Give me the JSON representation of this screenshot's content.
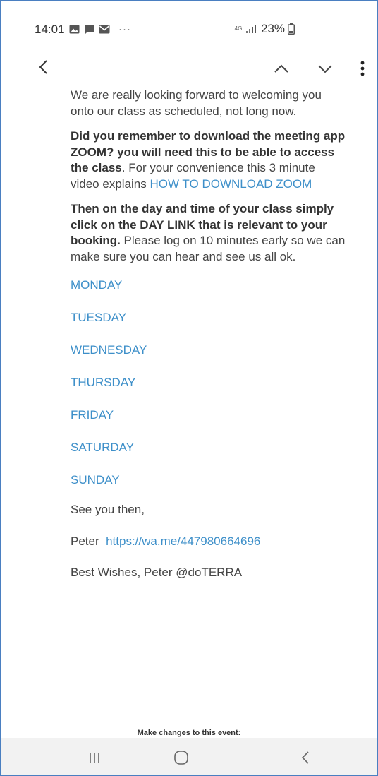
{
  "status_bar": {
    "time": "14:01",
    "ellipsis": "···",
    "network": "4G",
    "battery": "23%",
    "icons": [
      "gallery-icon",
      "chat-icon",
      "mail-icon",
      "signal-icon",
      "battery-icon"
    ]
  },
  "app_bar": {
    "icons": [
      "back-icon",
      "chevron-up-icon",
      "chevron-down-icon",
      "more-vertical-icon"
    ]
  },
  "email": {
    "p1": "We are really looking forward to welcoming you onto our class as scheduled, not long now.",
    "p2_bold": "Did you remember to download the meeting app ZOOM? you will need this to be able to access the class",
    "p2_text": ". For your convenience this 3 minute video explains ",
    "p2_link": "HOW TO DOWNLOAD ZOOM",
    "p3_bold": "Then on the day and time of your class simply click on the DAY LINK that is relevant to your booking.",
    "p3_text": " Please log on 10 minutes early so we can make sure you can hear and see us all ok.",
    "days": [
      "MONDAY",
      "TUESDAY",
      "WEDNESDAY",
      "THURSDAY",
      "FRIDAY",
      "SATURDAY",
      "SUNDAY"
    ],
    "see_you": "See you then,",
    "signoff_name": "Peter",
    "signoff_link": "https://wa.me/447980664696",
    "best_wishes": "Best Wishes, Peter @doTERRA",
    "make_changes": "Make changes to this event:"
  },
  "nav_bar": {
    "icons": [
      "recent-apps-icon",
      "home-icon",
      "nav-back-icon"
    ]
  },
  "colors": {
    "link": "#3d8fc9",
    "text": "#444444",
    "frame_border": "#4a7fc1",
    "nav_background": "#f2f2f2"
  }
}
